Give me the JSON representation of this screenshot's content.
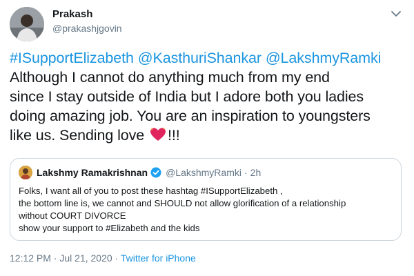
{
  "author": {
    "name": "Prakash",
    "handle": "@prakashjgovin"
  },
  "tweet": {
    "mentions": [
      "#ISupportElizabeth",
      "@KasthuriShankar",
      "@LakshmyRamki"
    ],
    "lines": [
      "Although I cannot do anything much from my end",
      "since I stay outside of India but I adore both you ladies",
      "doing amazing job. You are an inspiration to youngsters",
      "like us. Sending love"
    ],
    "emoji_icon": "sparkling-heart-icon",
    "trailing": "!!!"
  },
  "quoted": {
    "name": "Lakshmy Ramakrishnan",
    "verified_icon": "verified-badge-icon",
    "handle": "@LakshmyRamki",
    "separator": "·",
    "time": "2h",
    "lines": [
      "Folks, I want all of you to post these hashtag #ISupportElizabeth ,",
      "the bottom line is, we cannot and SHOULD not allow glorification of a relationship",
      "without COURT DIVORCE",
      "show your support to #Elizabeth and the kids"
    ]
  },
  "meta": {
    "timestamp": "12:12 PM · Jul 21, 2020 · ",
    "source": "Twitter for iPhone"
  },
  "colors": {
    "link": "#1b95e0",
    "secondary_text": "#657786",
    "border": "#ccd6dd",
    "verified": "#1da1f2",
    "heart": "#e0245e"
  }
}
